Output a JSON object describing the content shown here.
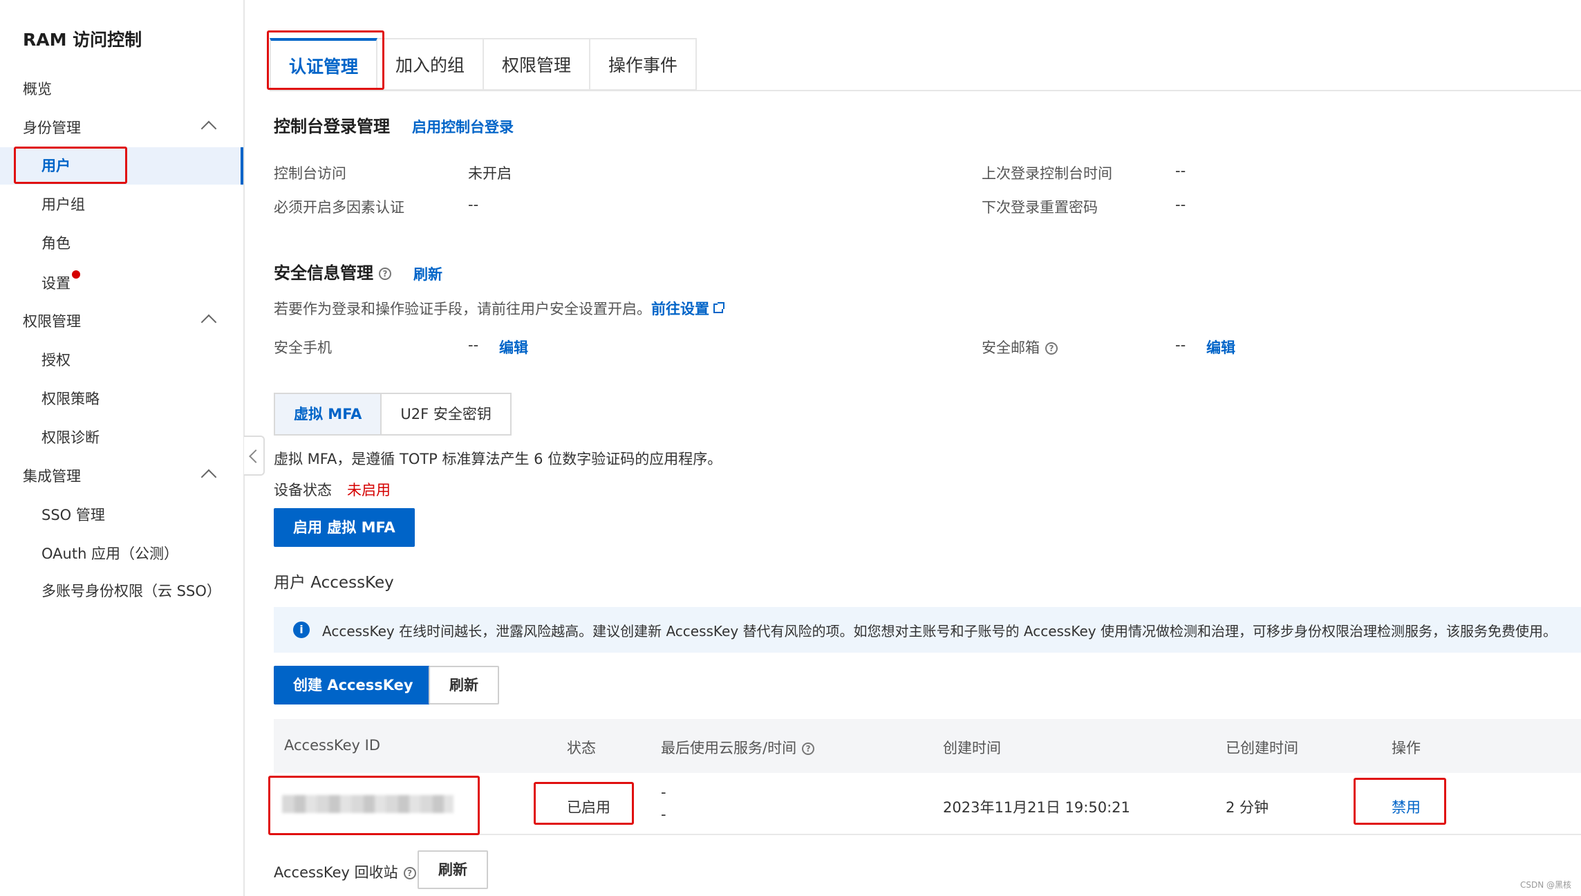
{
  "sidebar": {
    "title": "RAM 访问控制",
    "items": [
      {
        "label": "概览"
      },
      {
        "label": "身份管理"
      },
      {
        "label": "用户"
      },
      {
        "label": "用户组"
      },
      {
        "label": "角色"
      },
      {
        "label": "设置"
      },
      {
        "label": "权限管理"
      },
      {
        "label": "授权"
      },
      {
        "label": "权限策略"
      },
      {
        "label": "权限诊断"
      },
      {
        "label": "集成管理"
      },
      {
        "label": "SSO 管理"
      },
      {
        "label": "OAuth 应用（公测）"
      },
      {
        "label": "多账号身份权限（云 SSO）"
      }
    ]
  },
  "tabs": [
    "认证管理",
    "加入的组",
    "权限管理",
    "操作事件"
  ],
  "console": {
    "title": "控制台登录管理",
    "enable_link": "启用控制台登录",
    "access_label": "控制台访问",
    "access_value": "未开启",
    "mfa_required_label": "必须开启多因素认证",
    "mfa_required_value": "--",
    "last_login_label": "上次登录控制台时间",
    "last_login_value": "--",
    "reset_pwd_label": "下次登录重置密码",
    "reset_pwd_value": "--"
  },
  "security": {
    "title": "安全信息管理",
    "refresh_link": "刷新",
    "desc": "若要作为登录和操作验证手段，请前往用户安全设置开启。",
    "goto_link": "前往设置",
    "phone_label": "安全手机",
    "phone_value": "--",
    "phone_edit": "编辑",
    "email_label": "安全邮箱",
    "email_value": "--",
    "email_edit": "编辑"
  },
  "mfa": {
    "tabs": [
      "虚拟 MFA",
      "U2F 安全密钥"
    ],
    "desc": "虚拟 MFA，是遵循 TOTP 标准算法产生 6 位数字验证码的应用程序。",
    "status_label": "设备状态",
    "status_value": "未启用",
    "enable_button": "启用 虚拟 MFA"
  },
  "accesskey": {
    "title": "用户 AccessKey",
    "alert": "AccessKey 在线时间越长，泄露风险越高。建议创建新 AccessKey 替代有风险的项。如您想对主账号和子账号的 AccessKey 使用情况做检测和治理，可移步身份权限治理检测服务，该服务免费使用。",
    "create_button": "创建 AccessKey",
    "refresh_button": "刷新",
    "columns": [
      "AccessKey ID",
      "状态",
      "最后使用云服务/时间",
      "创建时间",
      "已创建时间",
      "操作"
    ],
    "rows": [
      {
        "status": "已启用",
        "last_used_1": "-",
        "last_used_2": "-",
        "created": "2023年11月21日 19:50:21",
        "age": "2 分钟",
        "action": "禁用"
      }
    ],
    "recycle_label": "AccessKey 回收站",
    "recycle_refresh": "刷新"
  },
  "watermark": "CSDN @黑核",
  "colors": {
    "primary": "#0064c8",
    "danger": "#d50000",
    "highlight_box": "#e01010"
  }
}
